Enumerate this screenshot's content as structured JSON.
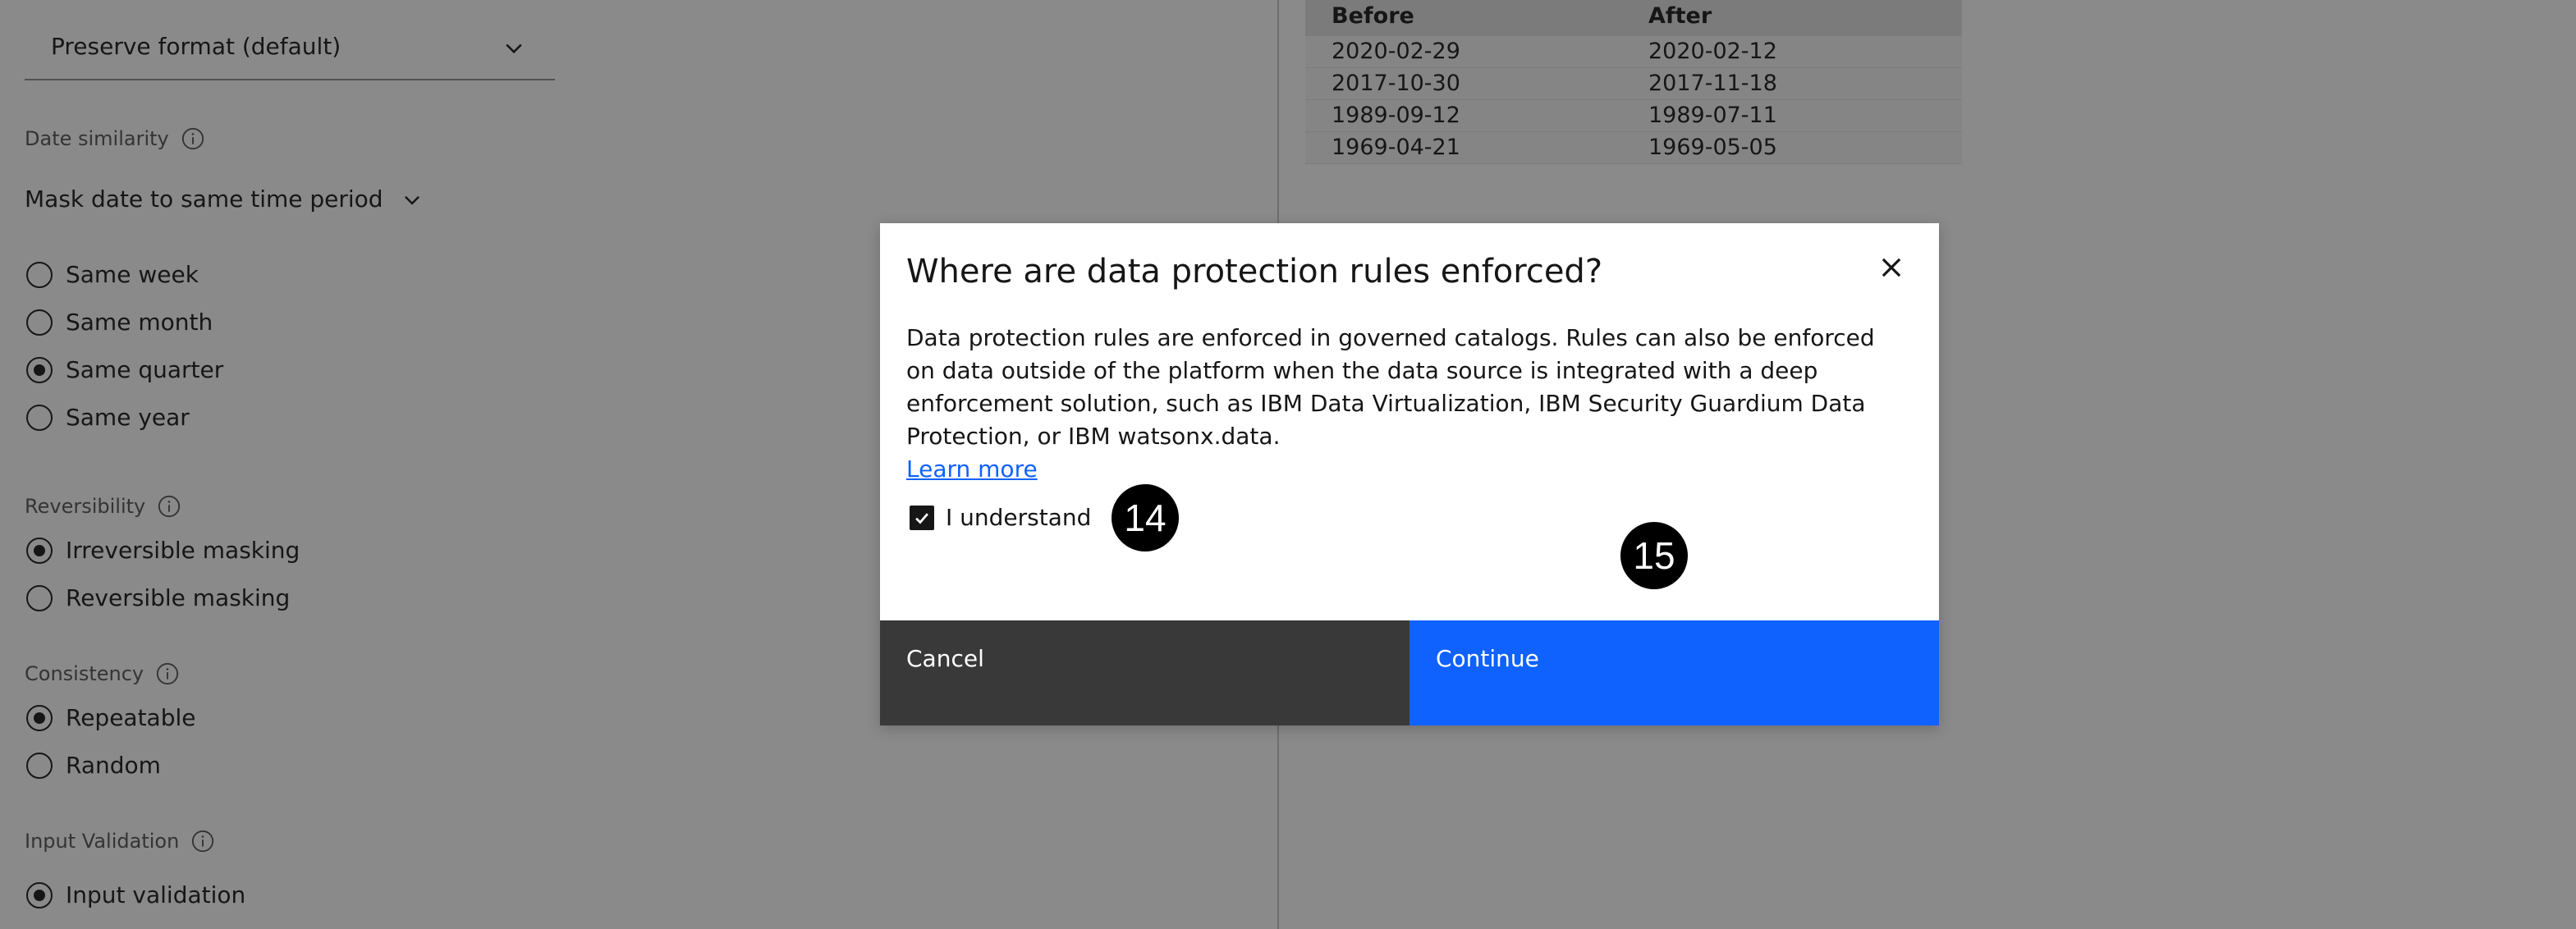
{
  "left": {
    "format_select": {
      "value": "Preserve format (default)"
    },
    "date_similarity": {
      "label": "Date similarity",
      "select_value": "Mask date to same time period",
      "options": [
        "Same week",
        "Same month",
        "Same quarter",
        "Same year"
      ],
      "selected": "Same quarter"
    },
    "reversibility": {
      "label": "Reversibility",
      "options": [
        "Irreversible masking",
        "Reversible masking"
      ],
      "selected": "Irreversible masking"
    },
    "consistency": {
      "label": "Consistency",
      "options": [
        "Repeatable",
        "Random"
      ],
      "selected": "Repeatable"
    },
    "input_validation": {
      "label": "Input Validation",
      "options": [
        "Input validation"
      ],
      "selected": "Input validation"
    }
  },
  "preview_table": {
    "headers": [
      "Before",
      "After"
    ],
    "rows": [
      [
        "2020-02-29",
        "2020-02-12"
      ],
      [
        "2017-10-30",
        "2017-11-18"
      ],
      [
        "1989-09-12",
        "1989-07-11"
      ],
      [
        "1969-04-21",
        "1969-05-05"
      ]
    ]
  },
  "modal": {
    "title": "Where are data protection rules enforced?",
    "body": "Data protection rules are enforced in governed catalogs. Rules can also be enforced on data outside of the platform when the data source is integrated with a deep enforcement solution, such as IBM Data Virtualization, IBM Security Guardium Data Protection, or IBM watsonx.data.",
    "link": "Learn more",
    "checkbox_label": "I understand",
    "checkbox_checked": true,
    "cancel_label": "Cancel",
    "continue_label": "Continue"
  },
  "badges": {
    "first": "14",
    "second": "15"
  },
  "colors": {
    "primary": "#0f62fe",
    "secondary": "#393939",
    "overlay": "rgba(22,22,22,0.5)"
  },
  "icons": [
    "chevron-down-icon",
    "info-icon",
    "close-icon",
    "checkmark-icon"
  ]
}
